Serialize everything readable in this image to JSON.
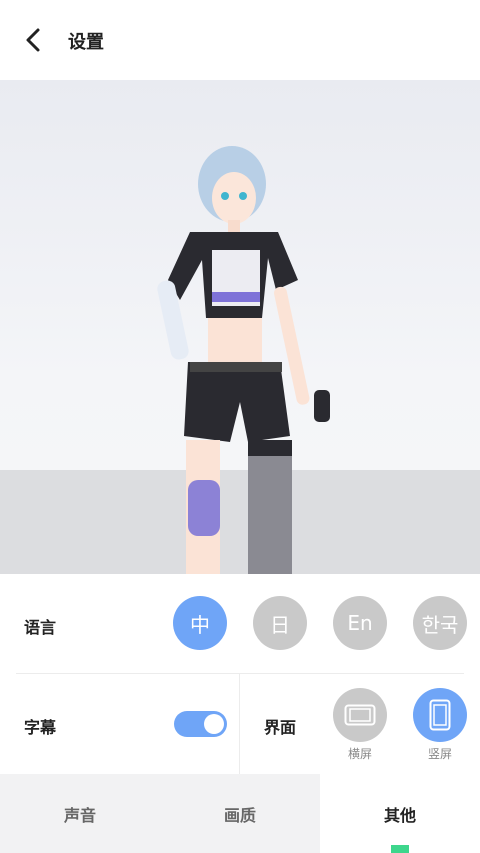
{
  "header": {
    "title": "设置",
    "back_icon": "chevron-left-icon"
  },
  "stage": {
    "character": "anime-character-model"
  },
  "settings": {
    "language": {
      "label": "语言",
      "options": [
        {
          "label": "中",
          "selected": true
        },
        {
          "label": "日",
          "selected": false
        },
        {
          "label": "En",
          "selected": false
        },
        {
          "label": "한국",
          "selected": false
        }
      ]
    },
    "subtitles": {
      "label": "字幕",
      "enabled": true
    },
    "orientation": {
      "label": "界面",
      "options": [
        {
          "label": "横屏",
          "icon": "landscape-icon",
          "selected": false
        },
        {
          "label": "竖屏",
          "icon": "portrait-icon",
          "selected": true
        }
      ]
    }
  },
  "tabs": [
    {
      "label": "声音",
      "active": false
    },
    {
      "label": "画质",
      "active": false
    },
    {
      "label": "其他",
      "active": true
    }
  ],
  "colors": {
    "accent": "#6fa5f7",
    "inactive": "#c9c9c9",
    "indicator": "#3dd68c"
  }
}
